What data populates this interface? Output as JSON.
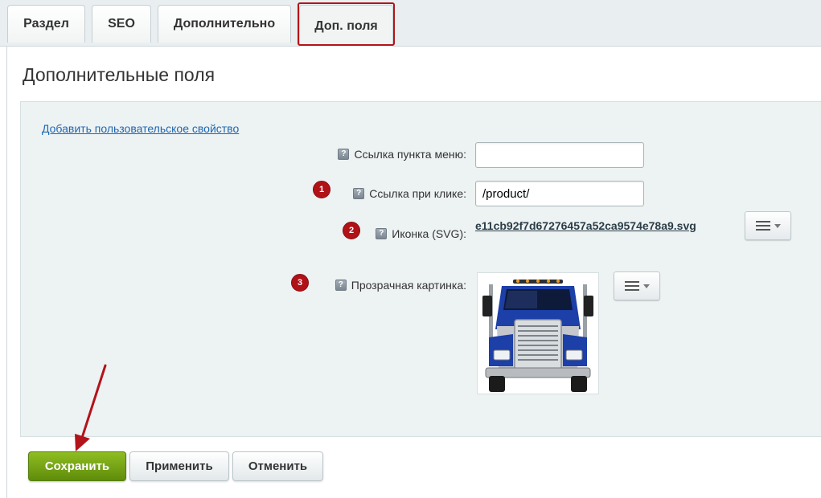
{
  "tabs": [
    {
      "label": "Раздел"
    },
    {
      "label": "SEO"
    },
    {
      "label": "Дополнительно"
    },
    {
      "label": "Доп. поля",
      "active": true
    }
  ],
  "page_title": "Дополнительные поля",
  "add_property_link": "Добавить пользовательское свойство",
  "fields": {
    "menu_link": {
      "label": "Ссылка пункта меню:",
      "value": ""
    },
    "click_link": {
      "label": "Ссылка при клике:",
      "value": "/product/",
      "badge": "1"
    },
    "icon_svg": {
      "label": "Иконка (SVG):",
      "file": "e11cb92f7d67276457a52ca9574e78a9.svg",
      "badge": "2"
    },
    "transparent_image": {
      "label": "Прозрачная картинка:",
      "badge": "3"
    }
  },
  "help_glyph": "?",
  "buttons": {
    "save": "Сохранить",
    "apply": "Применить",
    "cancel": "Отменить"
  },
  "colors": {
    "accent_red": "#b3131a",
    "save_green": "#7aa81a",
    "link_blue": "#2067b0"
  },
  "icons": [
    "help-icon",
    "menu-icon",
    "caret-down-icon",
    "truck-image",
    "annotation-arrow"
  ]
}
